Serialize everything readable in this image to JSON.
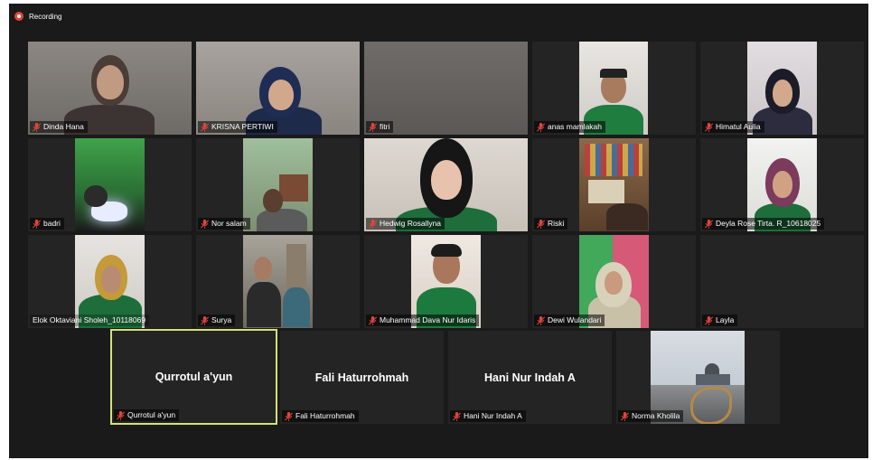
{
  "recording": {
    "label": "Recording"
  },
  "participants": [
    {
      "name": "Dinda Hana"
    },
    {
      "name": "KRISNA PERTIWI"
    },
    {
      "name": "fitri"
    },
    {
      "name": "anas mamlakah"
    },
    {
      "name": "Himatul Aulia"
    },
    {
      "name": "badri"
    },
    {
      "name": "Nor salam"
    },
    {
      "name": "Hedwig Rosallyna"
    },
    {
      "name": "Riski"
    },
    {
      "name": "Deyla Rose Tirta. R_10618025"
    },
    {
      "name": "Elok Oktaviani Sholeh_10118069"
    },
    {
      "name": "Surya"
    },
    {
      "name": "Muhammad Dava Nur Idaris"
    },
    {
      "name": "Dewi Wulandari"
    },
    {
      "name": "Layla"
    },
    {
      "name": "Qurrotul a'yun",
      "display": "Qurrotul a'yun"
    },
    {
      "name": "Fali Haturrohmah",
      "display": "Fali Haturrohmah"
    },
    {
      "name": "Hani Nur Indah A",
      "display": "Hani Nur Indah A"
    },
    {
      "name": "Norma Kholila"
    }
  ],
  "colors": {
    "active_speaker": "#d3e07a",
    "muted_mic": "#e0463a",
    "tile_bg": "#242424"
  }
}
